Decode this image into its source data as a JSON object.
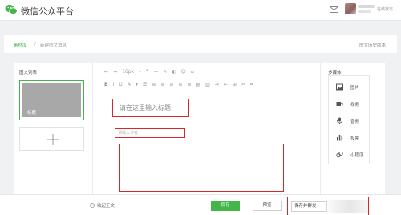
{
  "header": {
    "platform_title": "微信公众平台",
    "user_sub": "在线状态"
  },
  "breadcrumb": {
    "items": [
      "素材库",
      "新建图文消息"
    ],
    "separator": "/",
    "history_link": "图文历史版本"
  },
  "left_panel": {
    "title": "图文列表",
    "article_label": "标题"
  },
  "editor": {
    "toolbar_row1": [
      "←",
      "→",
      "16px",
      "▾",
      "❞",
      "—",
      "✎",
      "◐",
      "☺",
      "⌂"
    ],
    "toolbar_row2": [
      "B",
      "I",
      "U",
      "A",
      "▾",
      "☰",
      "≡",
      "≡",
      "≡",
      "≡",
      "≣",
      "▤",
      "▥",
      "⇥",
      "⇤",
      "⊞",
      "✂",
      "⌗"
    ],
    "title_placeholder": "请在这里输入标题",
    "author_placeholder": "请输入作者"
  },
  "right_panel": {
    "title": "多媒体",
    "items": [
      {
        "label": "图片",
        "icon": "image-icon"
      },
      {
        "label": "视频",
        "icon": "video-icon"
      },
      {
        "label": "音频",
        "icon": "audio-icon"
      },
      {
        "label": "投票",
        "icon": "vote-icon"
      },
      {
        "label": "小程序",
        "icon": "mini-program-icon"
      }
    ]
  },
  "footer": {
    "radio_label": "收起正文",
    "save_label": "保存",
    "preview_label": "预览",
    "publish_label": "保存并群发"
  },
  "colors": {
    "accent_green": "#44b549",
    "highlight_red": "#d9262c"
  }
}
